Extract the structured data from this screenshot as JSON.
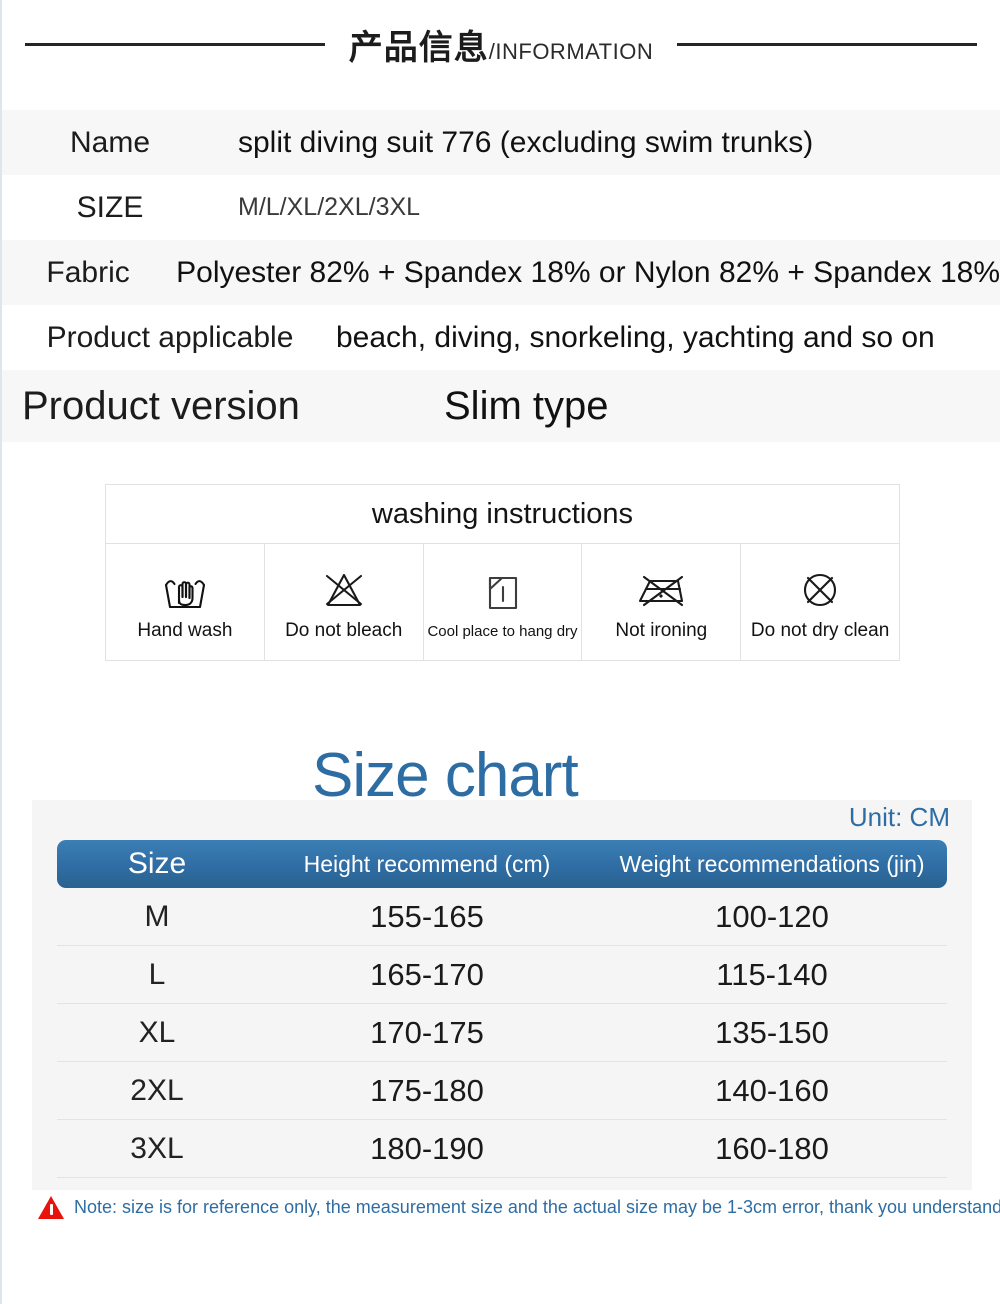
{
  "banner": {
    "title_cn": "产品信息",
    "title_en": "/INFORMATION"
  },
  "info_rows": [
    {
      "label": "Name",
      "value": "split diving suit 776 (excluding swim trunks)"
    },
    {
      "label": "SIZE",
      "value": "M/L/XL/2XL/3XL"
    },
    {
      "label": "Fabric",
      "value": "Polyester 82% + Spandex 18% or Nylon 82% + Spandex 18%"
    },
    {
      "label": "Product applicable",
      "value": "beach, diving, snorkeling, yachting and so on"
    },
    {
      "label": "Product version",
      "value": "Slim type"
    }
  ],
  "washing": {
    "title": "washing instructions",
    "items": [
      {
        "icon": "hand-wash-icon",
        "label": "Hand wash"
      },
      {
        "icon": "do-not-bleach-icon",
        "label": "Do not bleach"
      },
      {
        "icon": "hang-dry-icon",
        "label": "Cool place to hang dry"
      },
      {
        "icon": "not-ironing-icon",
        "label": "Not ironing"
      },
      {
        "icon": "do-not-dry-clean-icon",
        "label": "Do not dry clean"
      }
    ]
  },
  "size_chart": {
    "title": "Size chart",
    "unit": "Unit: CM",
    "accent_color": "#2e6da4",
    "headers": [
      "Size",
      "Height recommend (cm)",
      "Weight recommendations (jin)"
    ],
    "rows": [
      {
        "size": "M",
        "height": "155-165",
        "weight": "100-120"
      },
      {
        "size": "L",
        "height": "165-170",
        "weight": "115-140"
      },
      {
        "size": "XL",
        "height": "170-175",
        "weight": "135-150"
      },
      {
        "size": "2XL",
        "height": "175-180",
        "weight": "140-160"
      },
      {
        "size": "3XL",
        "height": "180-190",
        "weight": "160-180"
      }
    ]
  },
  "note": {
    "icon": "warning-triangle-icon",
    "text": "Note: size is for reference only, the measurement size and the actual size may be 1-3cm error, thank you understand",
    "color": "#2e6da4",
    "icon_color": "#e8140c"
  },
  "chart_data": {
    "type": "table",
    "title": "Size chart",
    "unit": "CM",
    "columns": [
      "Size",
      "Height recommend (cm)",
      "Weight recommendations (jin)"
    ],
    "rows": [
      [
        "M",
        "155-165",
        "100-120"
      ],
      [
        "L",
        "165-170",
        "115-140"
      ],
      [
        "XL",
        "170-175",
        "135-150"
      ],
      [
        "2XL",
        "175-180",
        "140-160"
      ],
      [
        "3XL",
        "180-190",
        "160-180"
      ]
    ]
  }
}
